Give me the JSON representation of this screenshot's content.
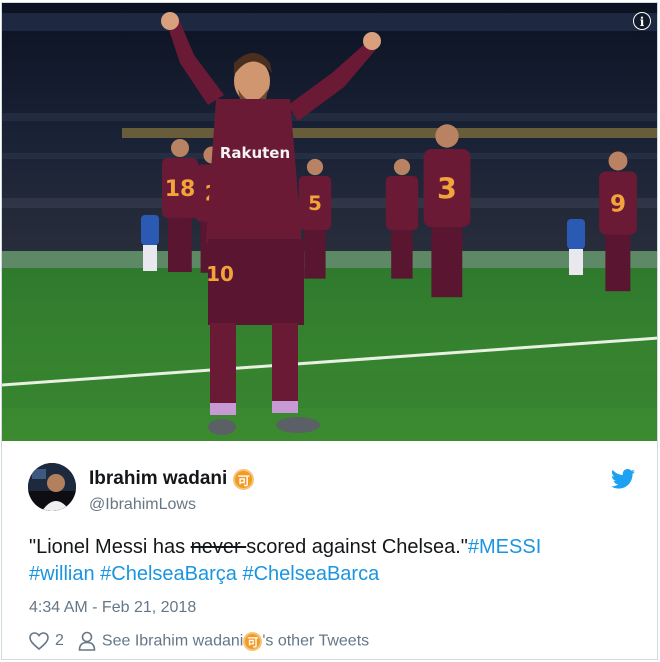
{
  "photo": {
    "alt_scene": "",
    "jersey_numbers": [
      "18",
      "2",
      "5",
      "3",
      "9",
      "10"
    ],
    "shirt_sponsor": "Rakuten"
  },
  "tweet": {
    "display_name": "Ibrahim wadani",
    "badge_glyph": "可",
    "handle": "@IbrahimLows",
    "text_part1": "\"Lionel Messi has ",
    "text_strike": "never ",
    "text_part2": "scored against Chelsea.\"",
    "hashtags": [
      "#MESSI",
      "#willian",
      "#ChelseaBarça",
      "#ChelseaBarca"
    ],
    "timestamp": "4:34 AM - Feb 21, 2018",
    "like_count": "2",
    "see_other_prefix": "See Ibrahim wadani",
    "see_other_suffix": "'s other Tweets"
  },
  "icons": {
    "info": "info-icon",
    "bird": "twitter-bird-icon",
    "heart": "heart-icon",
    "person": "person-icon"
  },
  "colors": {
    "link": "#1b95e0",
    "secondary_text": "#657786",
    "badge": "#f39a21",
    "jersey": "#6b1a35"
  }
}
